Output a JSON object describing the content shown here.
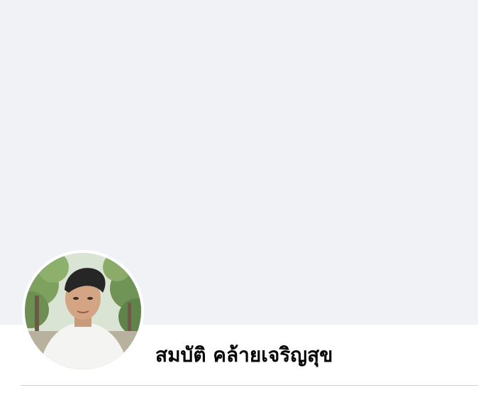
{
  "profile": {
    "name": "สมบัติ คล้ายเจริญสุข"
  },
  "colors": {
    "cover_background": "#f0f2f5",
    "name_text": "#050505",
    "divider": "#ced0d4"
  }
}
